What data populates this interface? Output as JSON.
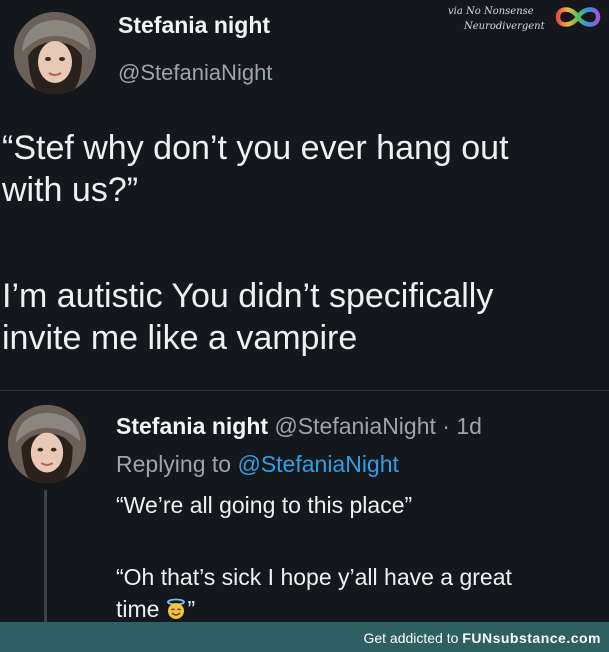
{
  "tweet": {
    "display_name": "Stefania night",
    "handle": "@StefaniaNight",
    "lines": [
      "“Stef why don’t you ever hang out",
      "with us?”",
      "I’m autistic You didn’t specifically",
      "invite me like a vampire"
    ]
  },
  "watermark": {
    "line1": "via No Nonsense",
    "line2": "Neurodivergent"
  },
  "reply": {
    "display_name": "Stefania night",
    "handle_time": "@StefaniaNight · 1d",
    "replying_prefix": "Replying to",
    "replying_handle": "@StefaniaNight",
    "line1": "“We’re all going to this place”",
    "line2": "“Oh that’s sick I hope y’all have a great",
    "line3_start": "time",
    "line3_end": "”"
  },
  "icons": {
    "watermark_logo": "infinity-rainbow-icon",
    "emoji": "smiling-face-with-halo-icon"
  },
  "footer": {
    "prefix": "Get addicted to ",
    "brand": "FUNsubstance.com"
  },
  "colors": {
    "background": "#14171c",
    "link": "#2f9fe6",
    "secondary_text": "#9ea4ab",
    "footer_bg": "#2e5f62"
  }
}
